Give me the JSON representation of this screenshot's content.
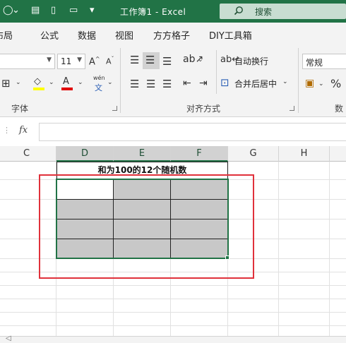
{
  "titlebar": {
    "title": "工作簿1  -  Excel",
    "search_label": "搜索",
    "accent": "#217346"
  },
  "tabs": [
    "布局",
    "公式",
    "数据",
    "视图",
    "方方格子",
    "DIY工具箱"
  ],
  "ribbon": {
    "font_size": "11",
    "wrap_text": "自动换行",
    "merge_center": "合并后居中",
    "number_format": "常规",
    "groups": {
      "font": "字体",
      "alignment": "对齐方式",
      "number": "数"
    },
    "phonetic_top": "wén",
    "phonetic_bottom": "文",
    "percent": "%"
  },
  "formula_bar": {
    "fx": "fx",
    "value": ""
  },
  "sheet": {
    "columns": [
      "C",
      "D",
      "E",
      "F",
      "G",
      "H"
    ],
    "selected_columns": [
      "D",
      "E",
      "F"
    ],
    "merged_title": "和为100的12个随机数"
  }
}
